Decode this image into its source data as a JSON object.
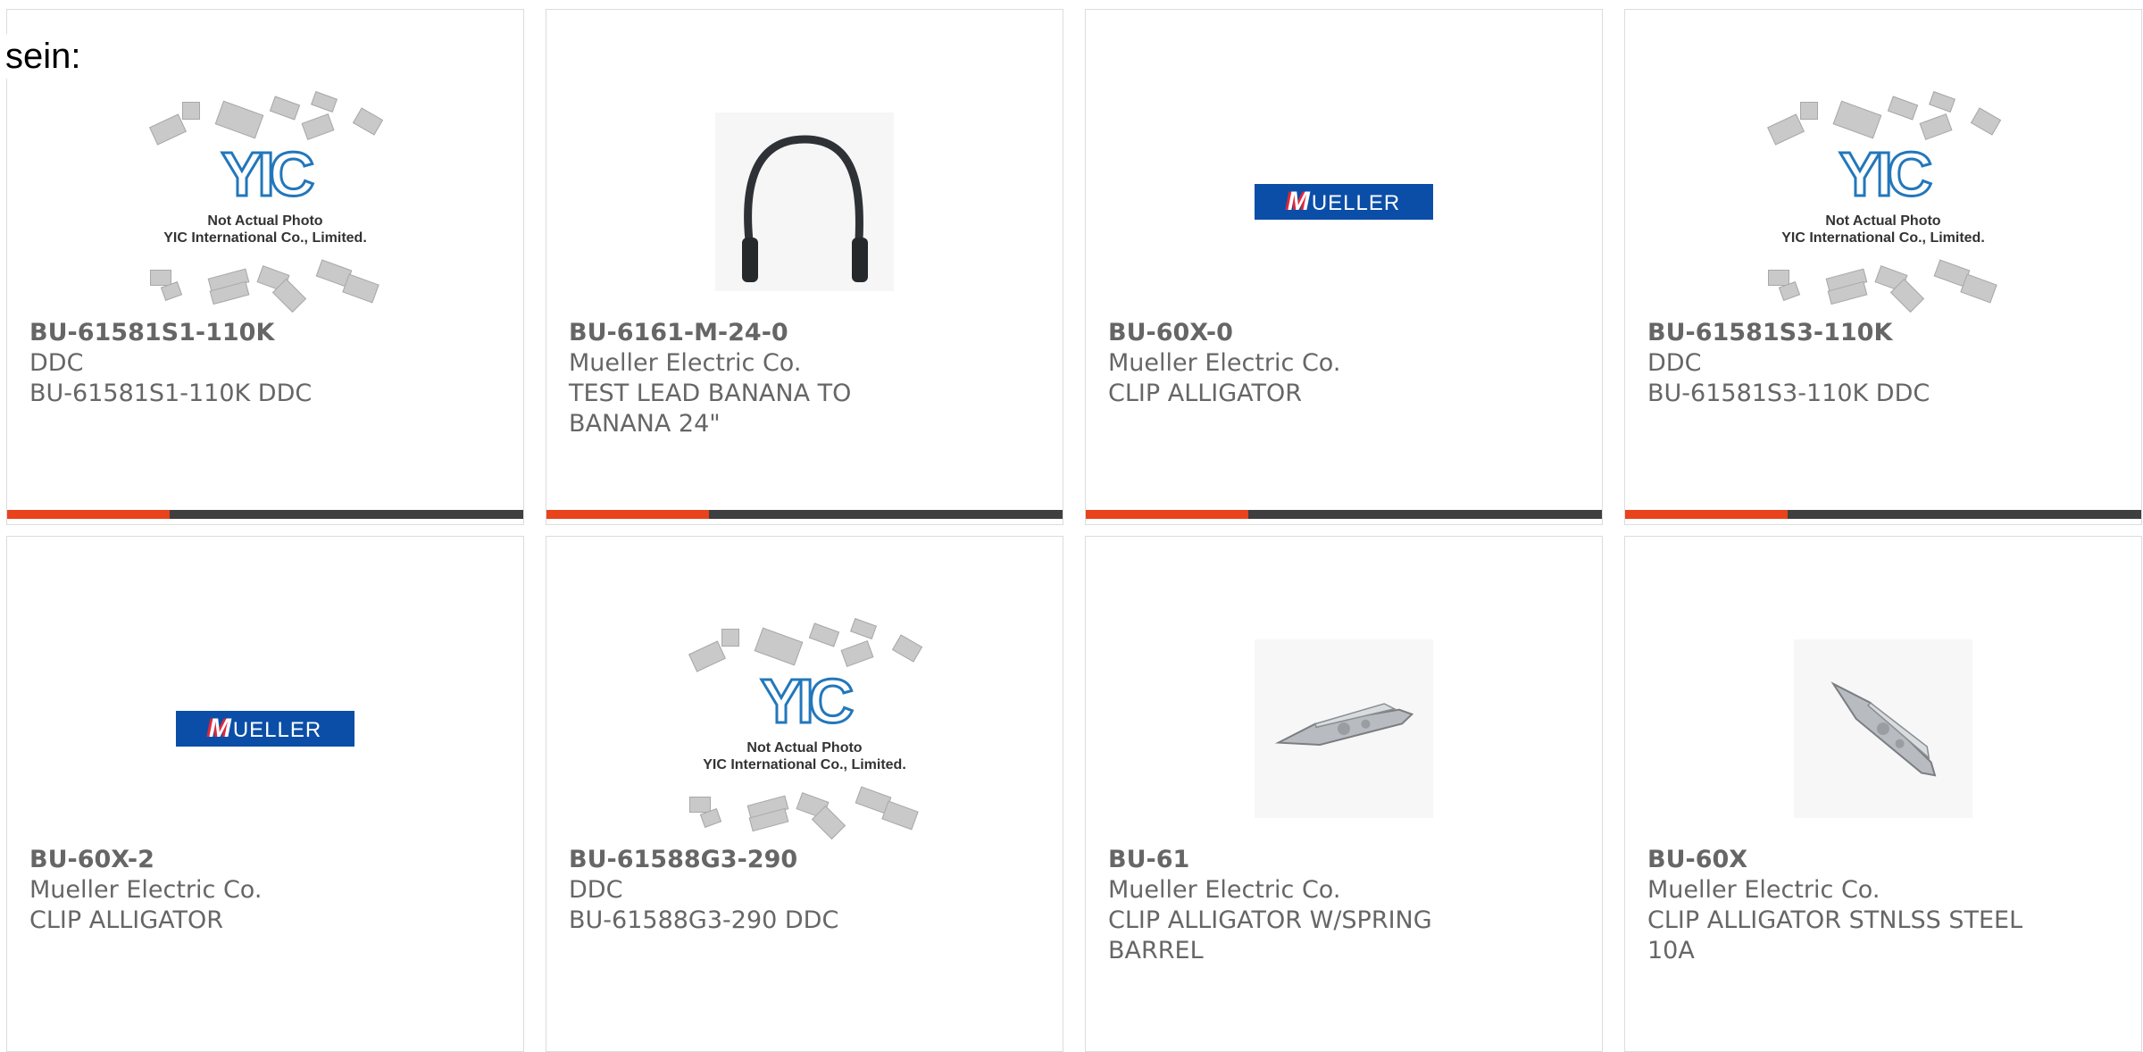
{
  "intro_text": "sein:",
  "placeholder": {
    "logo": "YIC",
    "line1": "Not Actual Photo",
    "line2": "YIC International Co., Limited."
  },
  "brand_logo": "MUELLER",
  "colors": {
    "accent": "#e8431c",
    "bar_dark": "#3f3f3f",
    "text": "#666666",
    "logo_blue": "#0b4ea8"
  },
  "products": [
    {
      "part_number": "BU-61581S1-110K",
      "manufacturer": "DDC",
      "description": "BU-61581S1-110K DDC",
      "image": "yic-placeholder"
    },
    {
      "part_number": "BU-6161-M-24-0",
      "manufacturer": "Mueller Electric Co.",
      "description": "TEST LEAD BANANA TO BANANA 24\"",
      "image": "test-lead-cable"
    },
    {
      "part_number": "BU-60X-0",
      "manufacturer": "Mueller Electric Co.",
      "description": "CLIP ALLIGATOR",
      "image": "mueller-logo"
    },
    {
      "part_number": "BU-61581S3-110K",
      "manufacturer": "DDC",
      "description": "BU-61581S3-110K DDC",
      "image": "yic-placeholder"
    },
    {
      "part_number": "BU-60X-2",
      "manufacturer": "Mueller Electric Co.",
      "description": "CLIP ALLIGATOR",
      "image": "mueller-logo"
    },
    {
      "part_number": "BU-61588G3-290",
      "manufacturer": "DDC",
      "description": "BU-61588G3-290 DDC",
      "image": "yic-placeholder"
    },
    {
      "part_number": "BU-61",
      "manufacturer": "Mueller Electric Co.",
      "description": "CLIP ALLIGATOR W/SPRING BARREL",
      "image": "alligator-clip"
    },
    {
      "part_number": "BU-60X",
      "manufacturer": "Mueller Electric Co.",
      "description": "CLIP ALLIGATOR STNLSS STEEL 10A",
      "image": "alligator-clip-angled"
    }
  ]
}
